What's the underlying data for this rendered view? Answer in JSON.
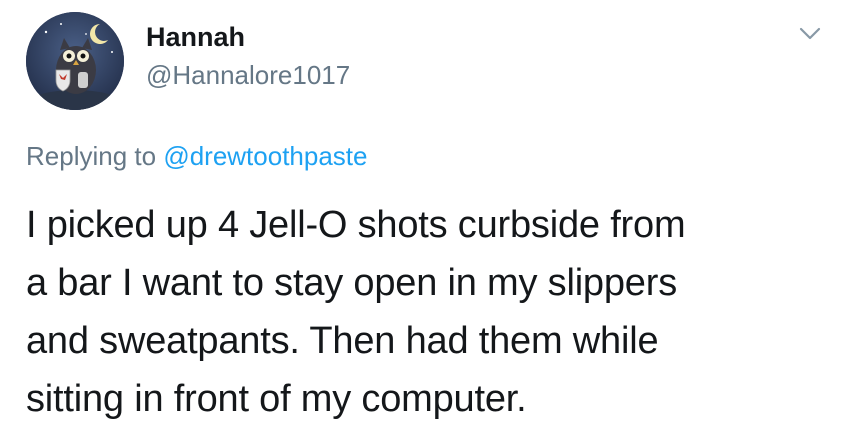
{
  "author": {
    "display_name": "Hannah",
    "handle": "@Hannalore1017",
    "avatar_icon": "owl-knight-avatar"
  },
  "menu": {
    "icon": "chevron-down-icon"
  },
  "reply": {
    "prefix": "Replying to",
    "mention": "@drewtoothpaste"
  },
  "body": {
    "lines": [
      "I picked up 4 Jell-O shots curbside from",
      "a bar I want to stay open in my slippers",
      "and sweatpants. Then had them while",
      "sitting in front of my computer."
    ]
  },
  "colors": {
    "text": "#14171a",
    "secondary": "#657786",
    "link": "#1da1f2"
  }
}
